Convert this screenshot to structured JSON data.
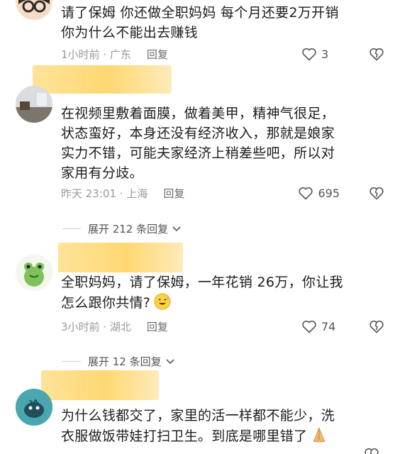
{
  "comments": [
    {
      "text_lines": [
        "请了保姆 你还做全职妈妈 每个月还要2万开销",
        "你为什么不能出去赚钱"
      ],
      "time": "1小时前 · 广东",
      "reply_label": "回复",
      "likes": "3"
    },
    {
      "text_lines": [
        "在视频里敷着面膜，做着美甲，精神气很足，",
        "状态蛮好，本身还没有经济收入，那就是娘家",
        "实力不错，可能夫家经济上稍差些吧，所以对",
        "家用有分歧。"
      ],
      "time": "昨天 23:01 · 上海",
      "reply_label": "回复",
      "likes": "695",
      "expand_label": "展开 212 条回复"
    },
    {
      "text_lines": [
        "全职妈妈，请了保姆，一年花销 26万，你让我",
        "怎么跟你共情?"
      ],
      "time": "3小时前 · 湖北",
      "reply_label": "回复",
      "likes": "74",
      "expand_label": "展开 12 条回复"
    },
    {
      "text_lines": [
        "为什么钱都交了，家里的活一样都不能少，洗",
        "衣服做饭带娃打扫卫生。到底是哪里错了"
      ]
    }
  ],
  "colors": {
    "text": "#1c1c1c",
    "meta": "#9a9a9a",
    "redaction": "#ffd873"
  }
}
